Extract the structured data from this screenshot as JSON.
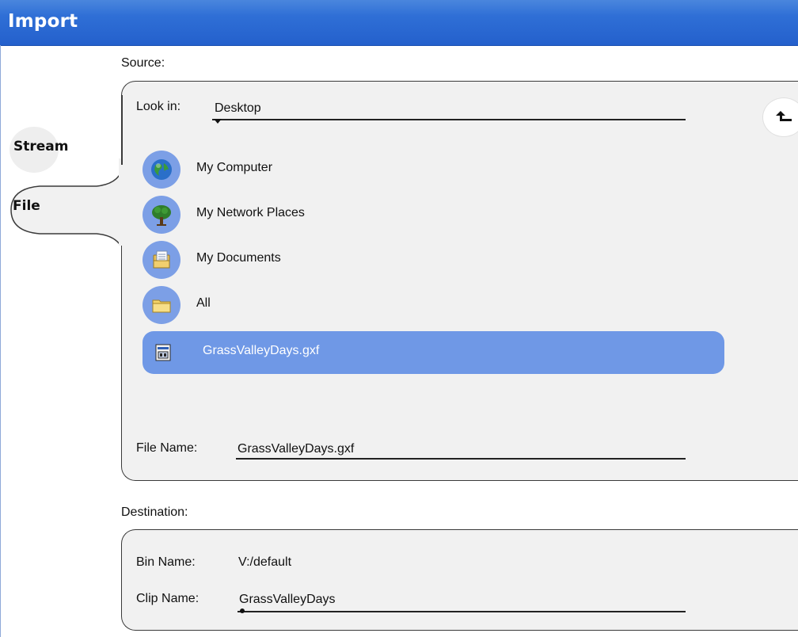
{
  "window": {
    "title": "Import"
  },
  "tabs": [
    {
      "label": "Stream"
    },
    {
      "label": "File"
    }
  ],
  "source": {
    "section_label": "Source:",
    "look_in_label": "Look in:",
    "look_in_value": "Desktop",
    "items": [
      {
        "label": "My Computer",
        "icon": "globe-icon"
      },
      {
        "label": "My Network Places",
        "icon": "tree-icon"
      },
      {
        "label": "My Documents",
        "icon": "documents-icon"
      },
      {
        "label": "All",
        "icon": "folder-icon"
      }
    ],
    "selected_file": {
      "label": "GrassValleyDays.gxf",
      "icon": "gxf-file-icon"
    },
    "file_name_label": "File Name:",
    "file_name_value": "GrassValleyDays.gxf"
  },
  "destination": {
    "section_label": "Destination:",
    "bin_name_label": "Bin Name:",
    "bin_name_value": "V:/default",
    "clip_name_label": "Clip Name:",
    "clip_name_value": "GrassValleyDays"
  },
  "colors": {
    "titlebar": "#2460cc",
    "selection": "#6f98e6",
    "icon_circle": "#7c9fe6",
    "panel": "#f1f1f1"
  }
}
